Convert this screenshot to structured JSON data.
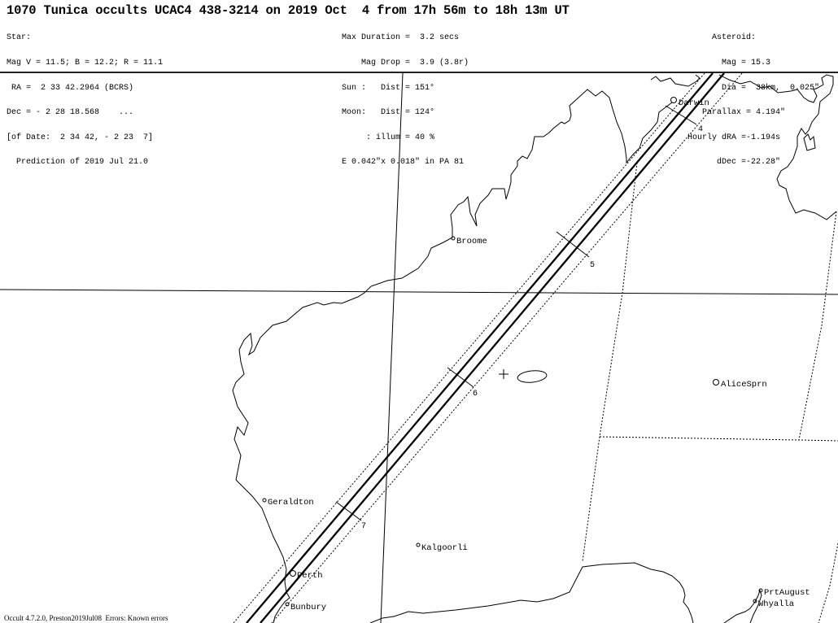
{
  "title": "1070 Tunica occults UCAC4 438-3214 on 2019 Oct  4 from 17h 56m to 18h 13m UT",
  "star": {
    "lines": [
      "Star:",
      "Mag V = 11.5; B = 12.2; R = 11.1",
      " RA =  2 33 42.2964 (BCRS)",
      "Dec = - 2 28 18.568    ...",
      "[of Date:  2 34 42, - 2 23  7]",
      "  Prediction of 2019 Jul 21.0"
    ]
  },
  "event": {
    "lines": [
      "Max Duration =  3.2 secs",
      "    Mag Drop =  3.9 (3.8r)",
      "Sun :   Dist = 151°",
      "Moon:   Dist = 124°",
      "     : illum = 40 %",
      "E 0.042\"x 0.018\" in PA 81"
    ]
  },
  "asteroid": {
    "lines": [
      "     Asteroid:",
      "       Mag = 15.3",
      "       Dia =  38km,  0.025\"",
      "   Parallax = 4.194\"",
      "Hourly dRA =-1.194s",
      "      dDec =-22.28\""
    ]
  },
  "footer": "Occult 4.7.2.0, Preston2019Jul08  Errors: Known errors",
  "map": {
    "cities": [
      {
        "name": "Darwin",
        "marker": "large"
      },
      {
        "name": "Broome",
        "marker": "small"
      },
      {
        "name": "AliceSprn",
        "marker": "large"
      },
      {
        "name": "Geraldton",
        "marker": "small"
      },
      {
        "name": "Kalgoorli",
        "marker": "small"
      },
      {
        "name": "Perth",
        "marker": "large"
      },
      {
        "name": "Bunbury",
        "marker": "small"
      },
      {
        "name": "PrtAugust",
        "marker": "small"
      },
      {
        "name": "Whyalla",
        "marker": "small"
      }
    ],
    "time_ticks": [
      "4",
      "5",
      "6",
      "7"
    ],
    "star_marker": "cross-icon",
    "error_ellipse": "ellipse-icon"
  }
}
